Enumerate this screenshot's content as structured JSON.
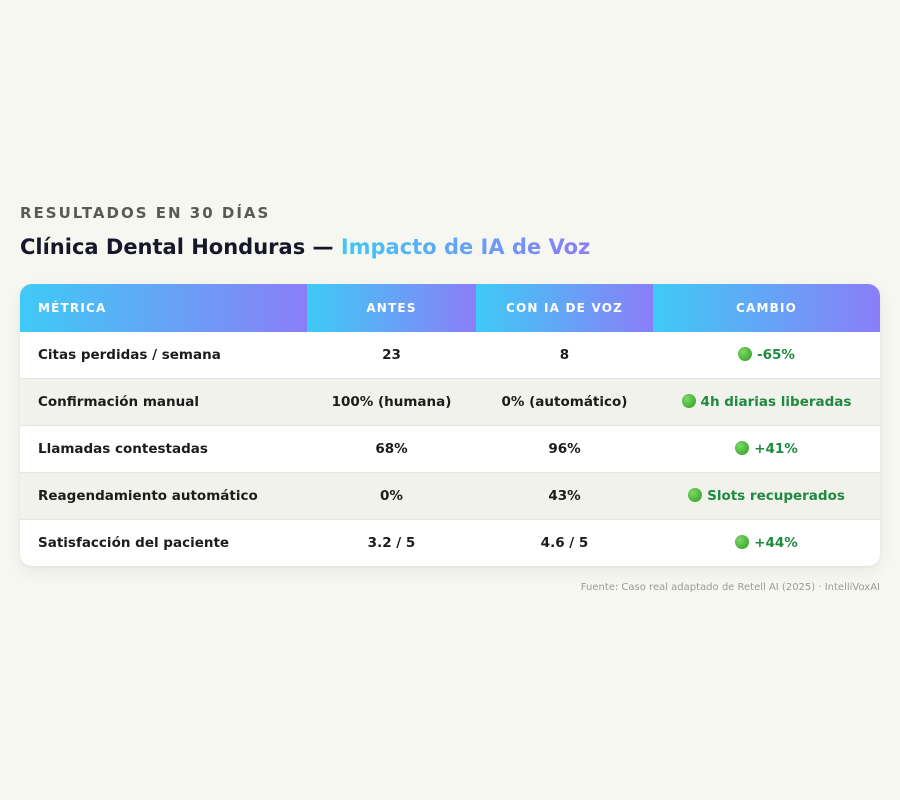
{
  "header": {
    "eyebrow": "RESULTADOS EN 30 DÍAS",
    "title_main": "Clínica Dental Honduras —",
    "title_accent": "Impacto de IA de Voz"
  },
  "table": {
    "columns": [
      "MÉTRICA",
      "ANTES",
      "CON IA DE VOZ",
      "CAMBIO"
    ],
    "rows": [
      {
        "metric": "Citas perdidas / semana",
        "before": "23",
        "with_ai": "8",
        "change": "-65%"
      },
      {
        "metric": "Confirmación manual",
        "before": "100% (humana)",
        "with_ai": "0% (automático)",
        "change": "4h diarias liberadas"
      },
      {
        "metric": "Llamadas contestadas",
        "before": "68%",
        "with_ai": "96%",
        "change": "+41%"
      },
      {
        "metric": "Reagendamiento automático",
        "before": "0%",
        "with_ai": "43%",
        "change": "Slots recuperados"
      },
      {
        "metric": "Satisfacción del paciente",
        "before": "3.2 / 5",
        "with_ai": "4.6 / 5",
        "change": "+44%"
      }
    ]
  },
  "footer": {
    "source": "Fuente: Caso real adaptado de Retell AI (2025) · IntelliVoxAI"
  },
  "colors": {
    "gradient_start": "#3fcaf6",
    "gradient_end": "#8a7ef7",
    "positive_text": "#1f8a3f",
    "status_dot": "green-circle"
  }
}
